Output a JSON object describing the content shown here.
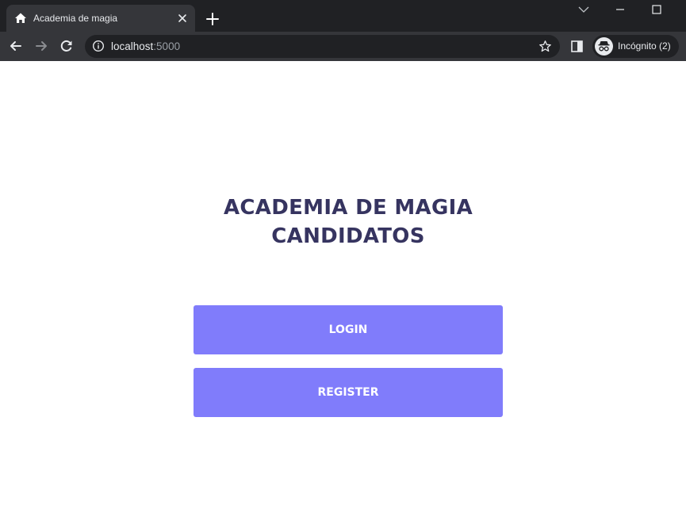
{
  "browser": {
    "tab_title": "Academia de magia",
    "url_host": "localhost",
    "url_port": ":5000",
    "profile_label": "Incógnito (2)"
  },
  "page": {
    "title_line1": "ACADEMIA DE MAGIA",
    "title_line2": "CANDIDATOS",
    "login_label": "LOGIN",
    "register_label": "REGISTER"
  },
  "colors": {
    "button": "#807cfb",
    "title": "#363460",
    "chrome_dark": "#202124",
    "chrome_toolbar": "#35363a"
  },
  "icons": {
    "favicon": "home-icon",
    "tab_close": "close-icon",
    "new_tab": "plus-icon",
    "back": "arrow-left-icon",
    "forward": "arrow-right-icon",
    "reload": "reload-icon",
    "site_info": "info-icon",
    "bookmark": "star-icon",
    "side_panel": "side-panel-icon",
    "profile": "incognito-icon"
  }
}
